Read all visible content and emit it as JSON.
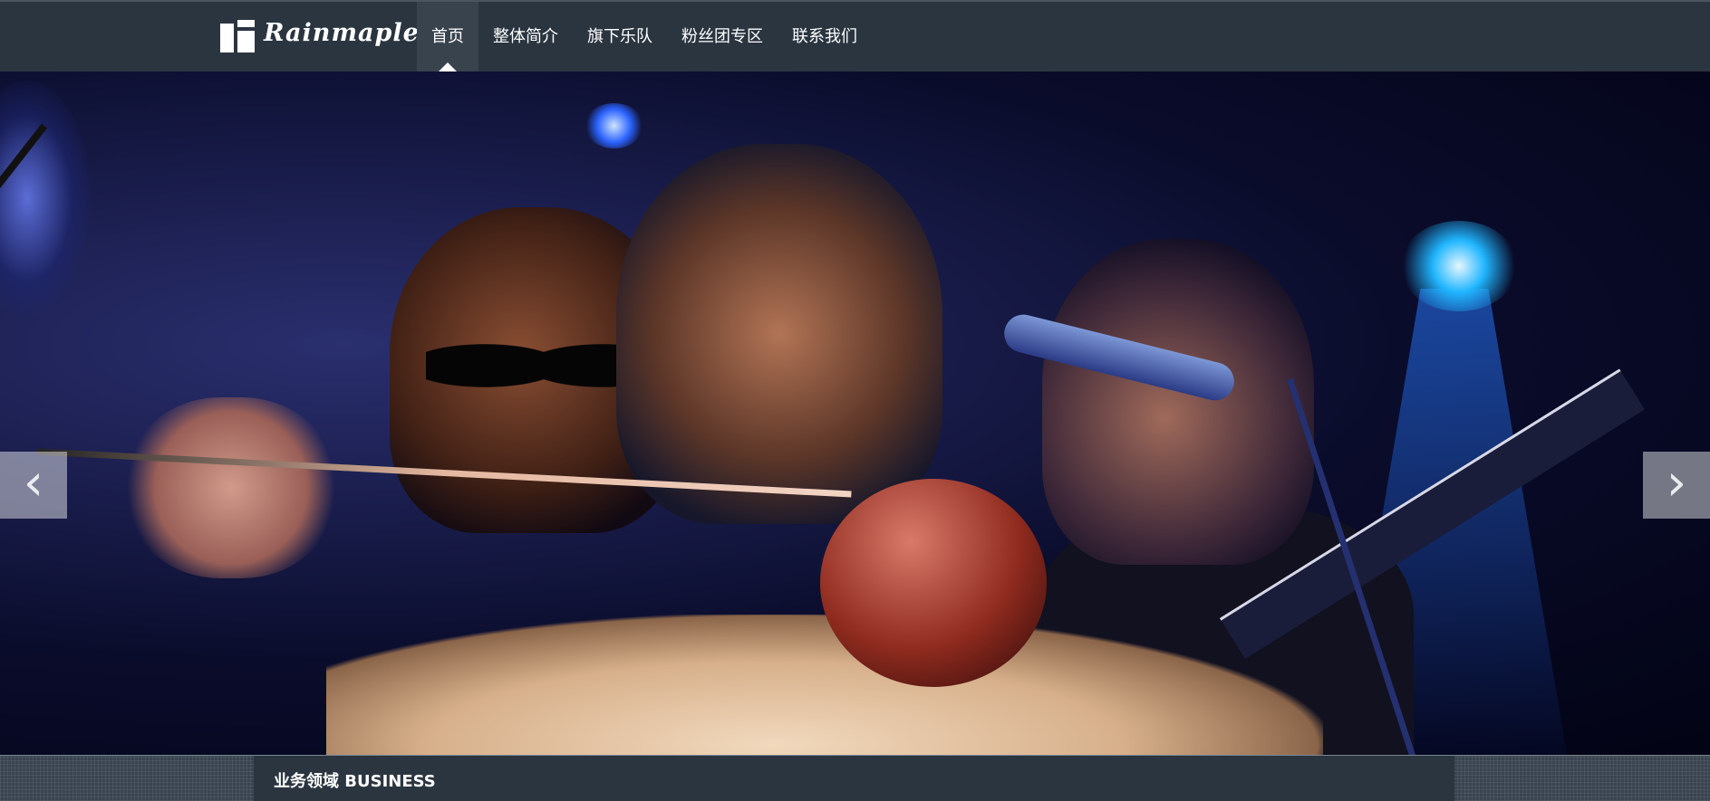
{
  "brand": {
    "logo_text": "Rainmaple"
  },
  "nav": {
    "items": [
      {
        "label": "首页",
        "active": true
      },
      {
        "label": "整体简介",
        "active": false
      },
      {
        "label": "旗下乐队",
        "active": false
      },
      {
        "label": "粉丝团专区",
        "active": false
      },
      {
        "label": "联系我们",
        "active": false
      }
    ]
  },
  "carousel": {
    "prev_icon": "chevron-left-icon",
    "next_icon": "chevron-right-icon",
    "prev_glyph": "‹",
    "next_glyph": "›",
    "slide_count": 5,
    "active_slide": 1,
    "active_color": "#f2b400",
    "inactive_color": "#111111"
  },
  "section": {
    "title": "业务领域 BUSINESS"
  },
  "colors": {
    "header_bg": "#2b3540",
    "active_nav_bg": "#38434e"
  }
}
